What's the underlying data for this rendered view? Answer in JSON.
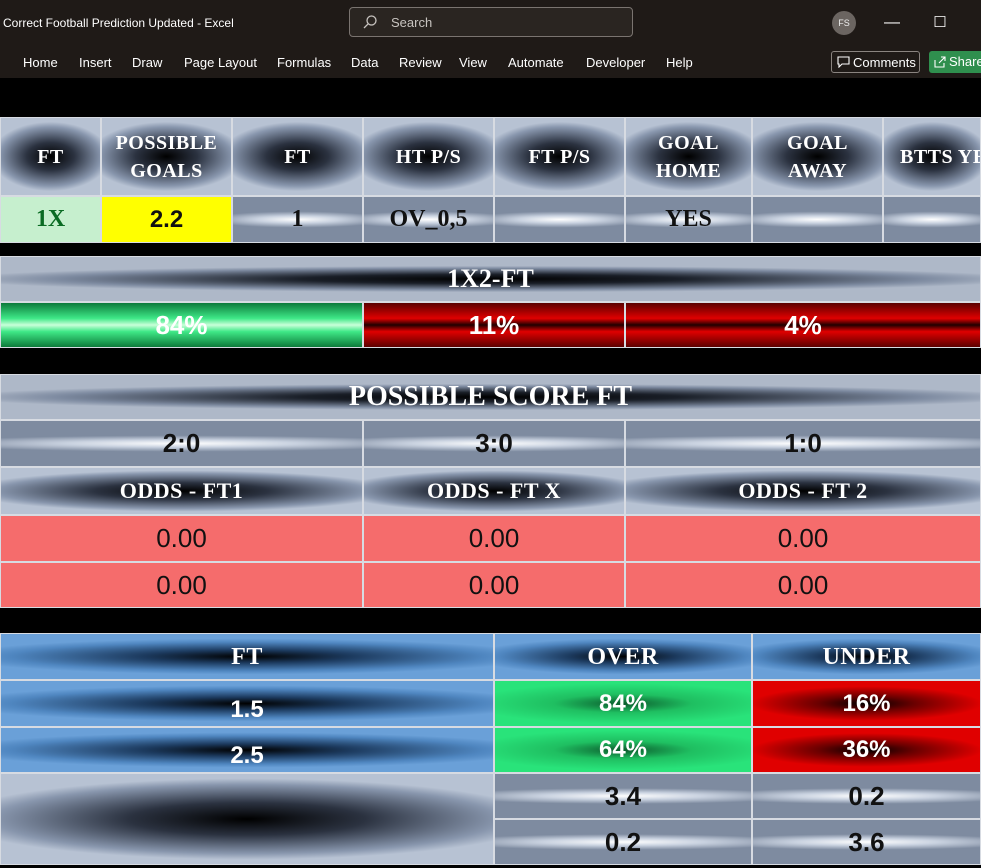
{
  "window": {
    "title": "Correct Football Prediction Updated  -  Excel",
    "search_placeholder": "Search",
    "user_initials": "FS",
    "minimize": "—",
    "maximize": "☐"
  },
  "menu": {
    "items": [
      "Home",
      "Insert",
      "Draw",
      "Page Layout",
      "Formulas",
      "Data",
      "Review",
      "View",
      "Automate",
      "Developer",
      "Help"
    ],
    "comments_label": "Comments",
    "share_label": "Share"
  },
  "summary_table": {
    "headers": [
      "FT",
      "POSSIBLE\nGOALS",
      "FT",
      "HT P/S",
      "FT P/S",
      "GOAL\nHOME",
      "GOAL\nAWAY",
      "BTTS YE"
    ],
    "values": [
      "1X",
      "2.2",
      "1",
      "OV_0,5",
      "",
      "YES",
      "",
      ""
    ]
  },
  "ft_1x2": {
    "title": "1X2-FT",
    "home_pct": "84%",
    "draw_pct": "11%",
    "away_pct": "4%"
  },
  "possible_score": {
    "title": "POSSIBLE SCORE FT",
    "scores": [
      "2:0",
      "3:0",
      "1:0"
    ],
    "odds_headers": [
      "ODDS - FT1",
      "ODDS - FT X",
      "ODDS - FT 2"
    ],
    "odds_row1": [
      "0.00",
      "0.00",
      "0.00"
    ],
    "odds_row2": [
      "0.00",
      "0.00",
      "0.00"
    ]
  },
  "over_under": {
    "headers": [
      "FT",
      "OVER",
      "UNDER"
    ],
    "rows": [
      {
        "line": "1.5",
        "over": "84%",
        "under": "16%"
      },
      {
        "line": "2.5",
        "over": "64%",
        "under": "36%"
      }
    ],
    "extra_rows": [
      {
        "over": "3.4",
        "under": "0.2"
      },
      {
        "over": "0.2",
        "under": "3.6"
      }
    ]
  },
  "colors": {
    "excel_titlebar": "#1f1a17",
    "green": "#29e37a",
    "red": "#e00000",
    "salmon": "#f56c6c",
    "yellow": "#ffff00",
    "light_green": "#c6efce",
    "blue": "#4f86c0"
  }
}
